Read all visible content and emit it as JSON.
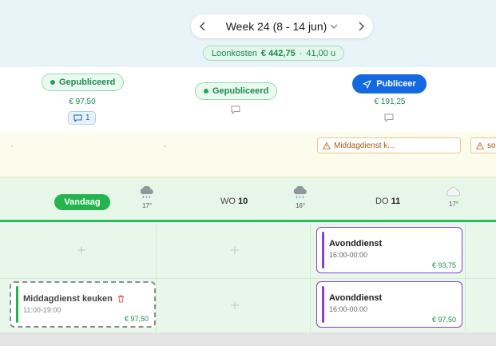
{
  "week_nav": {
    "label": "Week 24 (8 - 14 jun)"
  },
  "labor_cost": {
    "label": "Loonkosten",
    "amount": "€ 442,75",
    "separator": "·",
    "hours": "41,00 u"
  },
  "columns": [
    {
      "status": "Gepubliceerd",
      "cost": "€ 97,50",
      "comment_count": "1"
    },
    {
      "status": "Gepubliceerd"
    },
    {
      "publish_label": "Publiceer",
      "cost": "€ 191,25"
    }
  ],
  "warnings": {
    "dash_1": "-",
    "dash_2": "-",
    "warn_1": "Middagdienst k...",
    "warn_2": "so"
  },
  "days": {
    "today_label": "Vandaag",
    "wo": {
      "name": "WO",
      "num": "10"
    },
    "do": {
      "name": "DO",
      "num": "11"
    },
    "temps": [
      "17°",
      "16°",
      "17°"
    ]
  },
  "shifts": [
    {
      "title": "Avonddienst",
      "time": "16:00-00:00",
      "price": "€ 93,75"
    },
    {
      "title": "Avonddienst",
      "time": "16:00-00:00",
      "price": "€ 97,50"
    }
  ],
  "draft_shift": {
    "title": "Middagdienst keuken",
    "time": "11:00-19:00",
    "price": "€ 97,50"
  },
  "icons": {
    "prev": "chevron-left-icon",
    "next": "chevron-right-icon",
    "dropdown": "chevron-down-icon",
    "comment": "comment-icon",
    "send": "send-icon",
    "warning": "warning-icon",
    "rain": "rain-cloud-icon",
    "cloud": "cloud-icon",
    "delete": "trash-icon",
    "add": "plus-icon"
  },
  "colors": {
    "green": "#24b34f",
    "blue": "#1469e0",
    "purple": "#8a3fd0",
    "warning": "#f0c58a"
  }
}
